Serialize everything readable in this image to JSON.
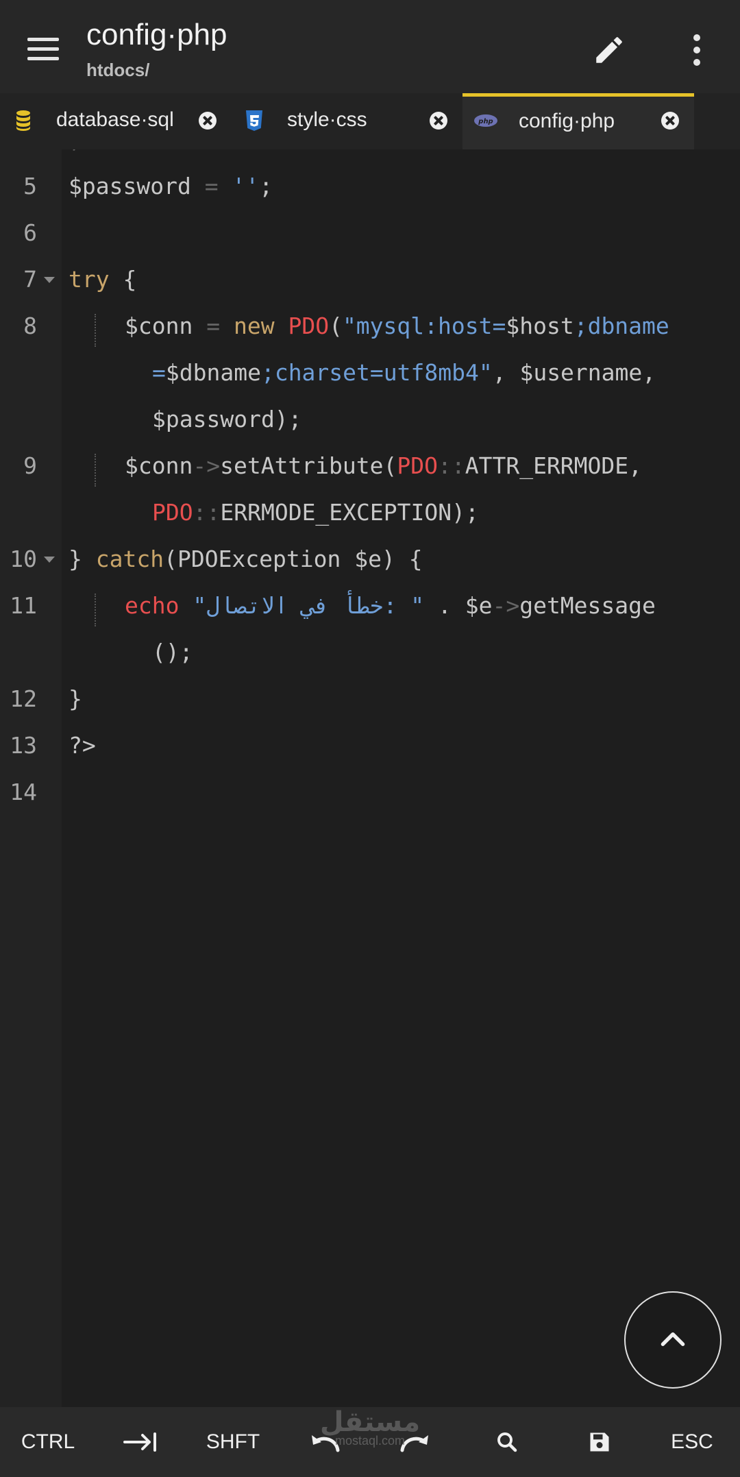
{
  "header": {
    "title": "config·php",
    "subtitle": "htdocs/"
  },
  "tabs": [
    {
      "label": "database·sql",
      "icon": "database-icon",
      "active": false
    },
    {
      "label": "style·css",
      "icon": "css3-icon",
      "active": false
    },
    {
      "label": "config·php",
      "icon": "php-icon",
      "active": true
    }
  ],
  "php_badge": "php",
  "colors": {
    "accent": "#e6c229",
    "keyword": "#c9a56a",
    "class": "#e84f4f",
    "string": "#6f9fd8"
  },
  "editor": {
    "line_numbers": [
      "5",
      "6",
      "7",
      "8",
      "9",
      "10",
      "11",
      "12",
      "13",
      "14"
    ],
    "code": {
      "l5_a": "$password ",
      "l5_b": "= ",
      "l5_c": "''",
      "l5_d": ";",
      "l7_a": "try",
      "l7_b": " {",
      "l8_a": "$conn ",
      "l8_b": "= ",
      "l8_c": "new ",
      "l8_d": "PDO",
      "l8_e": "(",
      "l8_f": "\"mysql:host=",
      "l8_g": "$host",
      "l8_h": ";dbname",
      "l8w1_a": "=",
      "l8w1_b": "$dbname",
      "l8w1_c": ";charset=utf8mb4\"",
      "l8w1_d": ", $username,",
      "l8w2": "$password);",
      "l9_a": "$conn",
      "l9_b": "->",
      "l9_c": "setAttribute(",
      "l9_d": "PDO",
      "l9_e": "::",
      "l9_f": "ATTR_ERRMODE,",
      "l9w_a": "PDO",
      "l9w_b": "::",
      "l9w_c": "ERRMODE_EXCEPTION);",
      "l10_a": "} ",
      "l10_b": "catch",
      "l10_c": "(PDOException $e) {",
      "l11_a": "echo ",
      "l11_b": "\"خطأ في الاتصال: \"",
      "l11_c": " . $e",
      "l11_d": "->",
      "l11_e": "getMessage",
      "l11w": "();",
      "l12": "}",
      "l13": "?>"
    }
  },
  "bottombar": {
    "ctrl": "CTRL",
    "shift": "SHFT",
    "esc": "ESC"
  },
  "watermark": {
    "main": "مستقل",
    "sub": "mostaql.com"
  }
}
